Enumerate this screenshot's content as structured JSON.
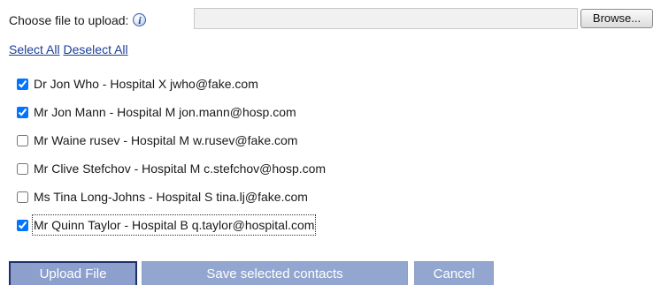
{
  "upload": {
    "label": "Choose file to upload:",
    "info_icon": "i",
    "file_value": "",
    "browse_label": "Browse..."
  },
  "selection": {
    "select_all": "Select All",
    "deselect_all": "Deselect All"
  },
  "contacts": [
    {
      "text": "Dr Jon Who - Hospital X jwho@fake.com",
      "checked": true
    },
    {
      "text": "Mr Jon Mann - Hospital M jon.mann@hosp.com",
      "checked": true
    },
    {
      "text": "Mr Waine rusev - Hospital M w.rusev@fake.com",
      "checked": false
    },
    {
      "text": "Mr Clive Stefchov - Hospital M c.stefchov@hosp.com",
      "checked": false
    },
    {
      "text": "Ms Tina Long-Johns - Hospital S tina.lj@fake.com",
      "checked": false
    },
    {
      "text": "Mr Quinn Taylor - Hospital B q.taylor@hospital.com",
      "checked": true,
      "focused": true
    }
  ],
  "actions": {
    "upload_label": "Upload File",
    "save_label": "Save selected contacts",
    "cancel_label": "Cancel"
  }
}
